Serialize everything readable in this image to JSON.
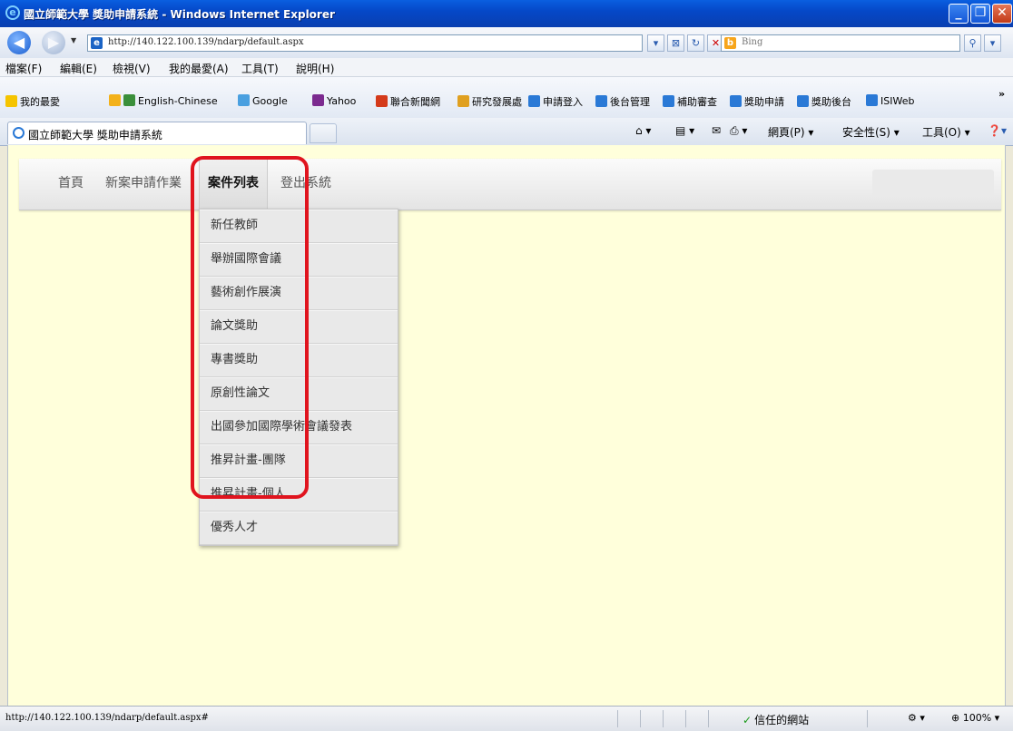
{
  "window": {
    "title": "國立師範大學 獎助申請系統 - Windows Internet Explorer"
  },
  "address": {
    "url": "http://140.122.100.139/ndarp/default.aspx",
    "search_placeholder": "Bing"
  },
  "menubar": [
    "檔案(F)",
    "編輯(E)",
    "檢視(V)",
    "我的最愛(A)",
    "工具(T)",
    "說明(H)"
  ],
  "favorites": {
    "label": "我的最愛",
    "items": [
      "English-Chinese",
      "Google",
      "Yahoo",
      "聯合新聞網",
      "研究發展處",
      "申請登入",
      "後台管理",
      "補助審查",
      "獎助申請",
      "獎助後台",
      "ISIWeb"
    ]
  },
  "tab": {
    "title": "國立師範大學 獎助申請系統"
  },
  "commandbar": {
    "page": "網頁(P) ▾",
    "safety": "安全性(S) ▾",
    "tools": "工具(O) ▾"
  },
  "site_nav": {
    "home": "首頁",
    "new_case": "新案申請作業",
    "case_list": "案件列表",
    "logout": "登出系統"
  },
  "dropdown": [
    "新任教師",
    "舉辦國際會議",
    "藝術創作展演",
    "論文獎助",
    "專書獎助",
    "原創性論文",
    "出國參加國際學術會議發表",
    "推昇計畫-團隊",
    "推昇計畫-個人",
    "優秀人才"
  ],
  "statusbar": {
    "url": "http://140.122.100.139/ndarp/default.aspx#",
    "zone": "信任的網站",
    "zoom": "100%"
  }
}
